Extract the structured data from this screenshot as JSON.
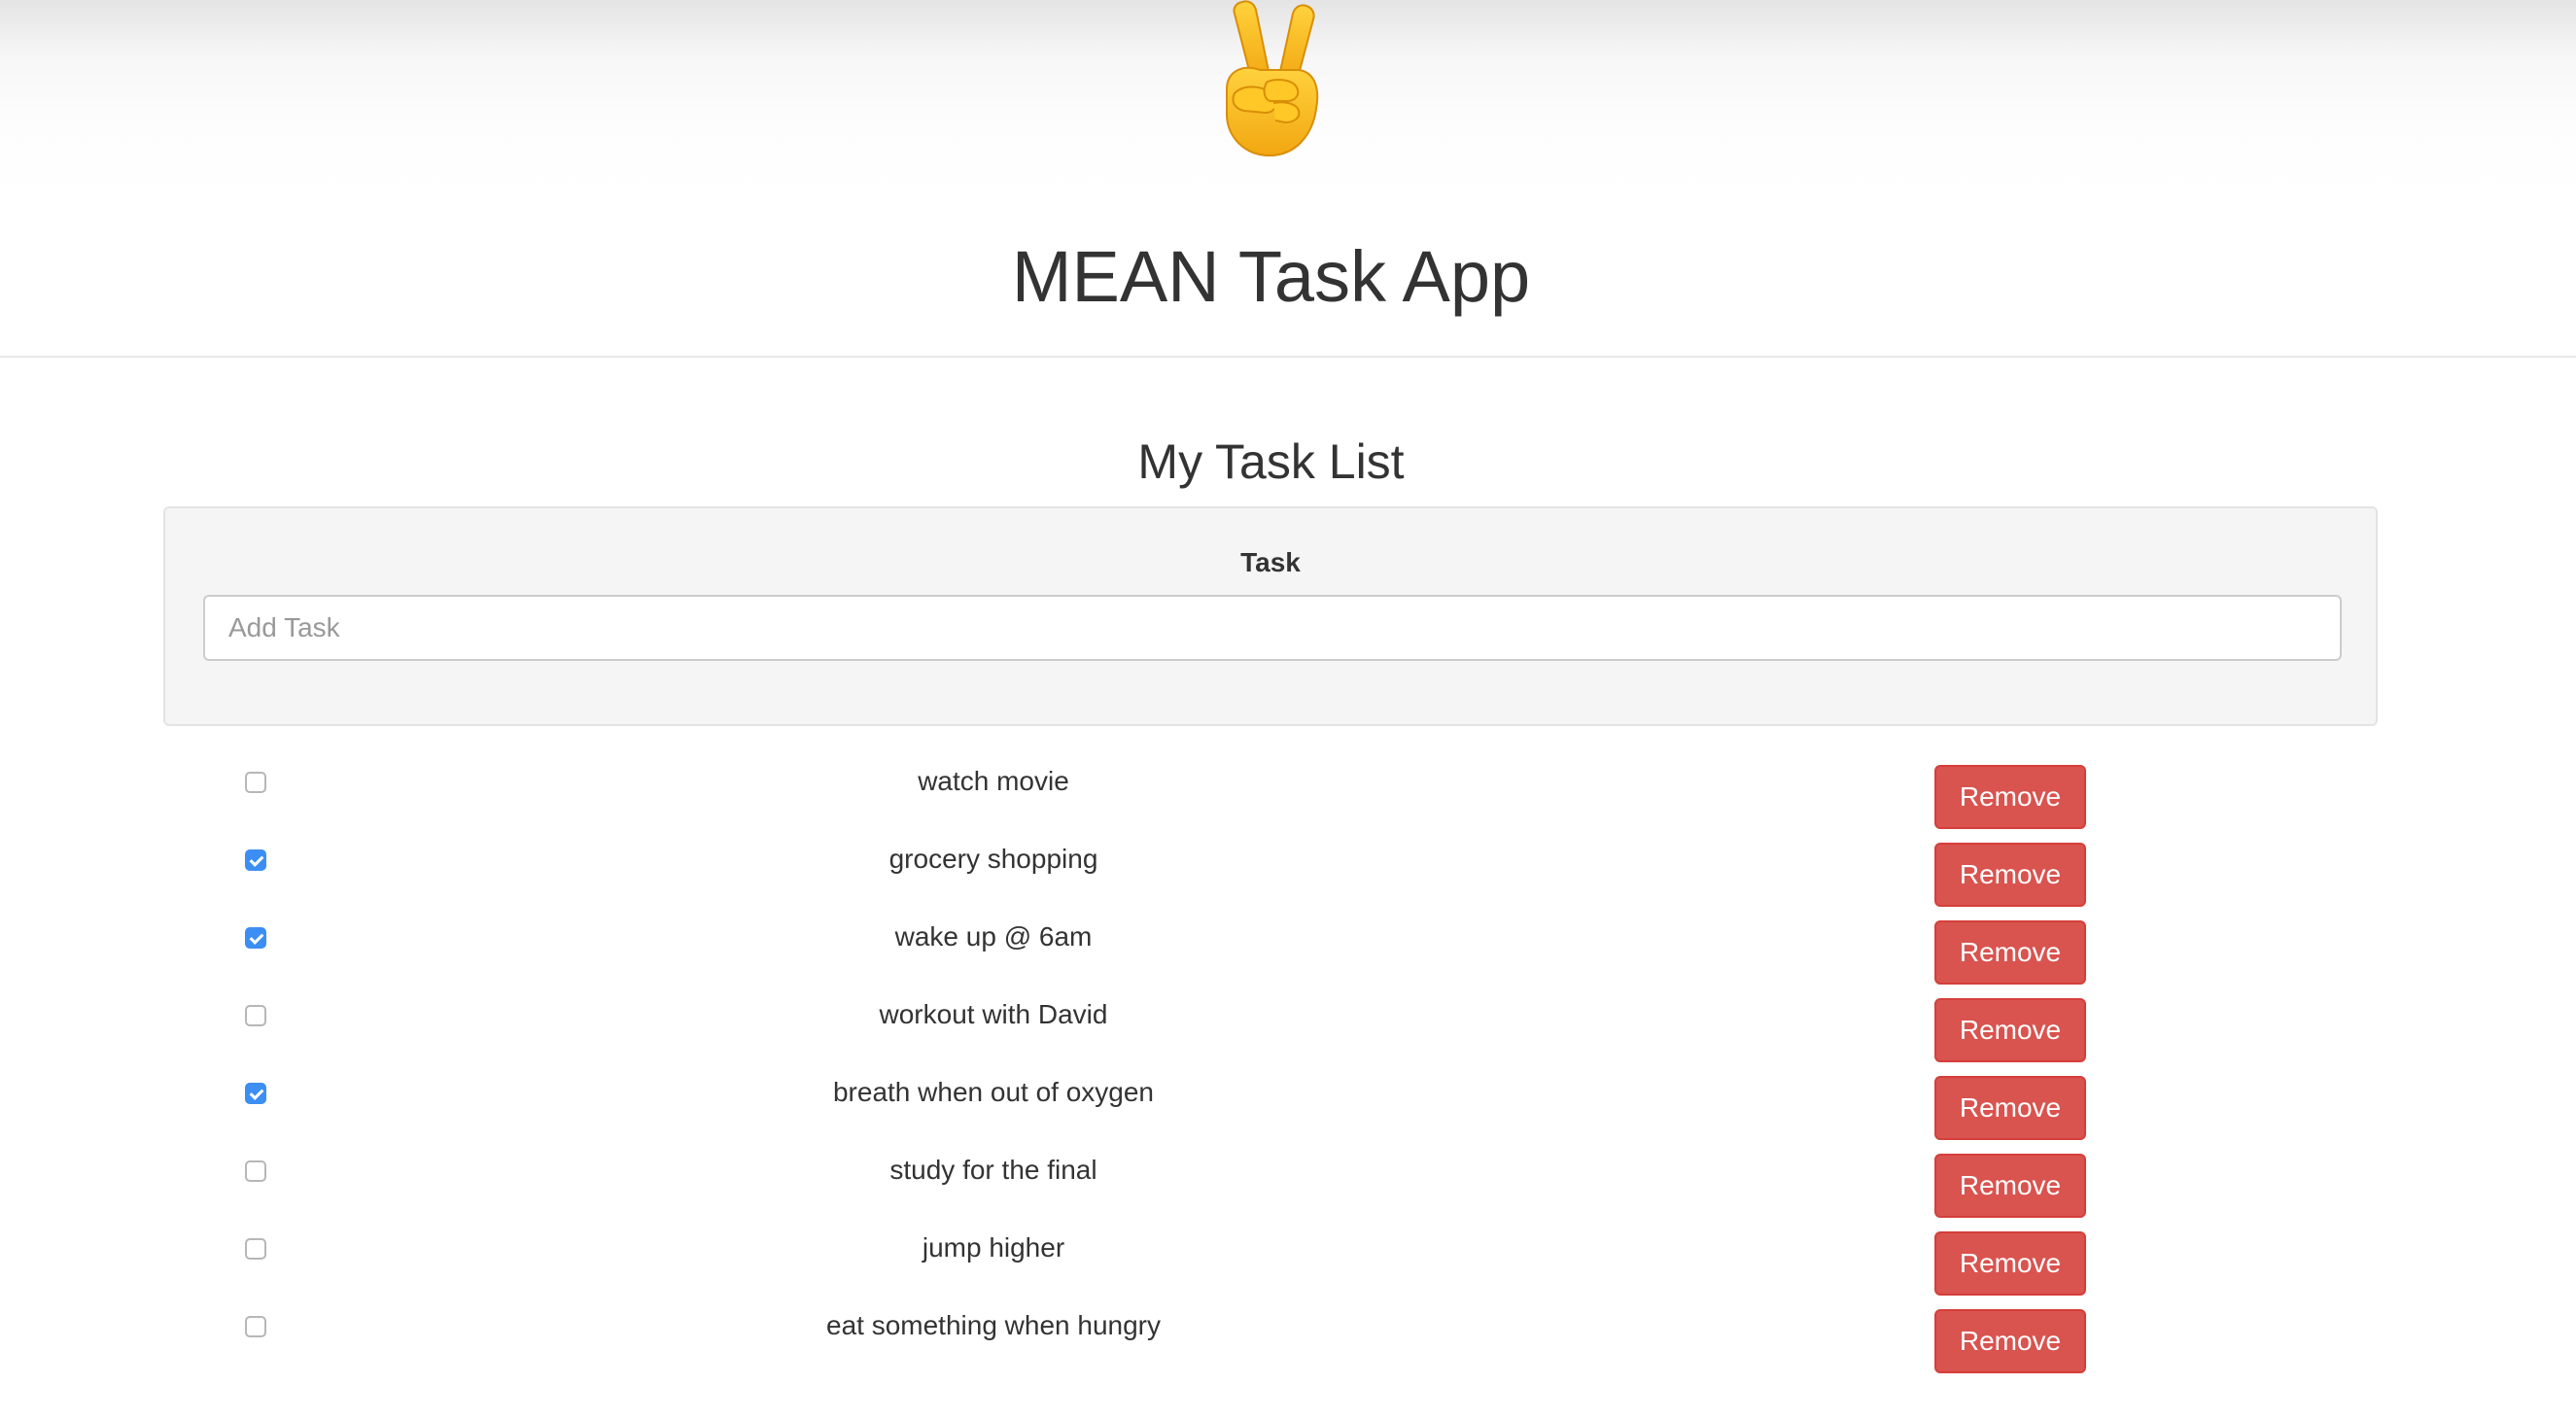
{
  "header": {
    "logo_icon": "victory-hand-emoji",
    "title": "MEAN Task App"
  },
  "main": {
    "section_title": "My Task List",
    "form": {
      "label": "Task",
      "input_placeholder": "Add Task",
      "input_value": ""
    },
    "remove_label": "Remove",
    "tasks": [
      {
        "title": "watch movie",
        "done": false
      },
      {
        "title": "grocery shopping",
        "done": true
      },
      {
        "title": "wake up @ 6am",
        "done": true
      },
      {
        "title": "workout with David",
        "done": false
      },
      {
        "title": "breath when out of oxygen",
        "done": true
      },
      {
        "title": "study for the final",
        "done": false
      },
      {
        "title": "jump higher",
        "done": false
      },
      {
        "title": "eat something when hungry",
        "done": false
      }
    ]
  },
  "colors": {
    "danger": "#d9534f",
    "checkbox_accent": "#3c8ef2",
    "panel_bg": "#f5f5f5",
    "text": "#333333"
  }
}
